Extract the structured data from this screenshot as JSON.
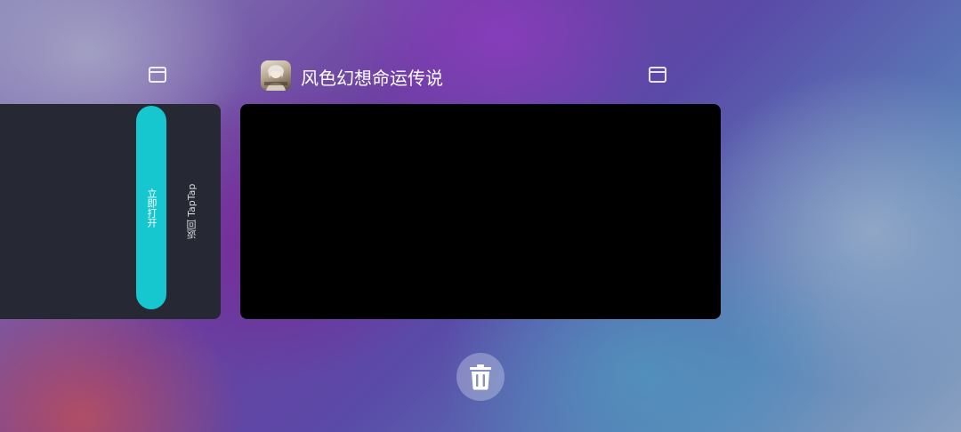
{
  "recents": {
    "left_card": {
      "open_button_label": "立即打开",
      "back_label": "返回 TapTap",
      "header_icon": "window-icon"
    },
    "main_card": {
      "app_name": "风色幻想命运传说",
      "app_icon": "app-icon",
      "header_icon": "window-icon"
    },
    "clear_button": {
      "icon": "trash-icon"
    }
  },
  "colors": {
    "open_button": "#16c7cf",
    "left_card_bg": "#262833",
    "main_card_bg": "#000000"
  }
}
